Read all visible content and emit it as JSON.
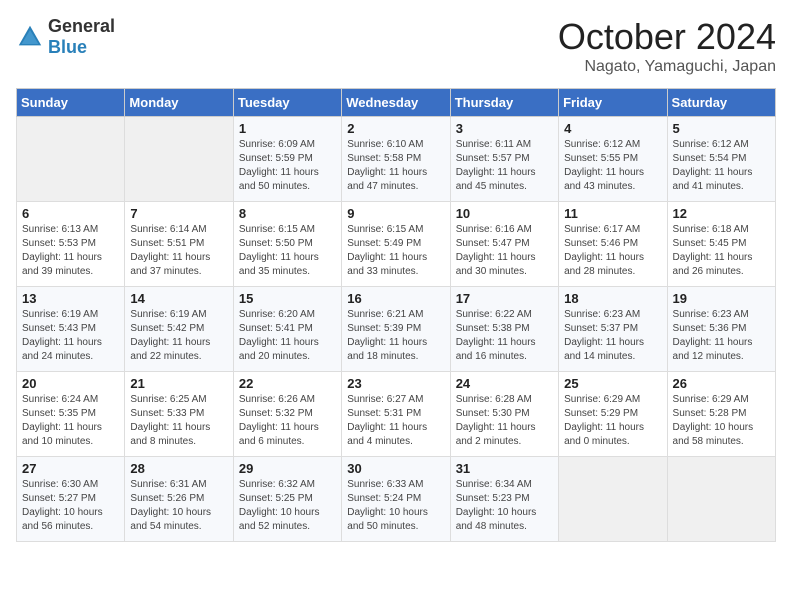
{
  "logo": {
    "text_general": "General",
    "text_blue": "Blue"
  },
  "header": {
    "month": "October 2024",
    "location": "Nagato, Yamaguchi, Japan"
  },
  "weekdays": [
    "Sunday",
    "Monday",
    "Tuesday",
    "Wednesday",
    "Thursday",
    "Friday",
    "Saturday"
  ],
  "weeks": [
    [
      {
        "day": "",
        "info": ""
      },
      {
        "day": "",
        "info": ""
      },
      {
        "day": "1",
        "info": "Sunrise: 6:09 AM\nSunset: 5:59 PM\nDaylight: 11 hours and 50 minutes."
      },
      {
        "day": "2",
        "info": "Sunrise: 6:10 AM\nSunset: 5:58 PM\nDaylight: 11 hours and 47 minutes."
      },
      {
        "day": "3",
        "info": "Sunrise: 6:11 AM\nSunset: 5:57 PM\nDaylight: 11 hours and 45 minutes."
      },
      {
        "day": "4",
        "info": "Sunrise: 6:12 AM\nSunset: 5:55 PM\nDaylight: 11 hours and 43 minutes."
      },
      {
        "day": "5",
        "info": "Sunrise: 6:12 AM\nSunset: 5:54 PM\nDaylight: 11 hours and 41 minutes."
      }
    ],
    [
      {
        "day": "6",
        "info": "Sunrise: 6:13 AM\nSunset: 5:53 PM\nDaylight: 11 hours and 39 minutes."
      },
      {
        "day": "7",
        "info": "Sunrise: 6:14 AM\nSunset: 5:51 PM\nDaylight: 11 hours and 37 minutes."
      },
      {
        "day": "8",
        "info": "Sunrise: 6:15 AM\nSunset: 5:50 PM\nDaylight: 11 hours and 35 minutes."
      },
      {
        "day": "9",
        "info": "Sunrise: 6:15 AM\nSunset: 5:49 PM\nDaylight: 11 hours and 33 minutes."
      },
      {
        "day": "10",
        "info": "Sunrise: 6:16 AM\nSunset: 5:47 PM\nDaylight: 11 hours and 30 minutes."
      },
      {
        "day": "11",
        "info": "Sunrise: 6:17 AM\nSunset: 5:46 PM\nDaylight: 11 hours and 28 minutes."
      },
      {
        "day": "12",
        "info": "Sunrise: 6:18 AM\nSunset: 5:45 PM\nDaylight: 11 hours and 26 minutes."
      }
    ],
    [
      {
        "day": "13",
        "info": "Sunrise: 6:19 AM\nSunset: 5:43 PM\nDaylight: 11 hours and 24 minutes."
      },
      {
        "day": "14",
        "info": "Sunrise: 6:19 AM\nSunset: 5:42 PM\nDaylight: 11 hours and 22 minutes."
      },
      {
        "day": "15",
        "info": "Sunrise: 6:20 AM\nSunset: 5:41 PM\nDaylight: 11 hours and 20 minutes."
      },
      {
        "day": "16",
        "info": "Sunrise: 6:21 AM\nSunset: 5:39 PM\nDaylight: 11 hours and 18 minutes."
      },
      {
        "day": "17",
        "info": "Sunrise: 6:22 AM\nSunset: 5:38 PM\nDaylight: 11 hours and 16 minutes."
      },
      {
        "day": "18",
        "info": "Sunrise: 6:23 AM\nSunset: 5:37 PM\nDaylight: 11 hours and 14 minutes."
      },
      {
        "day": "19",
        "info": "Sunrise: 6:23 AM\nSunset: 5:36 PM\nDaylight: 11 hours and 12 minutes."
      }
    ],
    [
      {
        "day": "20",
        "info": "Sunrise: 6:24 AM\nSunset: 5:35 PM\nDaylight: 11 hours and 10 minutes."
      },
      {
        "day": "21",
        "info": "Sunrise: 6:25 AM\nSunset: 5:33 PM\nDaylight: 11 hours and 8 minutes."
      },
      {
        "day": "22",
        "info": "Sunrise: 6:26 AM\nSunset: 5:32 PM\nDaylight: 11 hours and 6 minutes."
      },
      {
        "day": "23",
        "info": "Sunrise: 6:27 AM\nSunset: 5:31 PM\nDaylight: 11 hours and 4 minutes."
      },
      {
        "day": "24",
        "info": "Sunrise: 6:28 AM\nSunset: 5:30 PM\nDaylight: 11 hours and 2 minutes."
      },
      {
        "day": "25",
        "info": "Sunrise: 6:29 AM\nSunset: 5:29 PM\nDaylight: 11 hours and 0 minutes."
      },
      {
        "day": "26",
        "info": "Sunrise: 6:29 AM\nSunset: 5:28 PM\nDaylight: 10 hours and 58 minutes."
      }
    ],
    [
      {
        "day": "27",
        "info": "Sunrise: 6:30 AM\nSunset: 5:27 PM\nDaylight: 10 hours and 56 minutes."
      },
      {
        "day": "28",
        "info": "Sunrise: 6:31 AM\nSunset: 5:26 PM\nDaylight: 10 hours and 54 minutes."
      },
      {
        "day": "29",
        "info": "Sunrise: 6:32 AM\nSunset: 5:25 PM\nDaylight: 10 hours and 52 minutes."
      },
      {
        "day": "30",
        "info": "Sunrise: 6:33 AM\nSunset: 5:24 PM\nDaylight: 10 hours and 50 minutes."
      },
      {
        "day": "31",
        "info": "Sunrise: 6:34 AM\nSunset: 5:23 PM\nDaylight: 10 hours and 48 minutes."
      },
      {
        "day": "",
        "info": ""
      },
      {
        "day": "",
        "info": ""
      }
    ]
  ]
}
